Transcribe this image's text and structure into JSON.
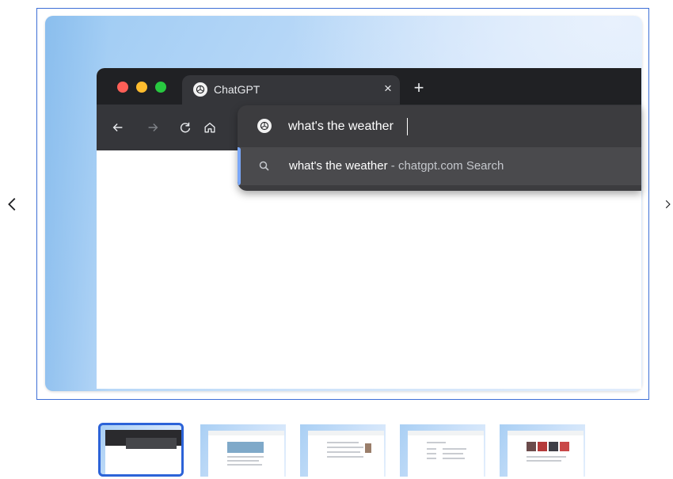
{
  "viewer": {
    "prev_label": "<",
    "next_label": ">",
    "selected_index": 0,
    "thumbnail_count": 5
  },
  "browser": {
    "tab": {
      "title": "ChatGPT",
      "favicon": "chatgpt-logo-icon",
      "close_glyph": "×"
    },
    "new_tab_glyph": "+",
    "toolbar": {
      "icons": [
        "back-arrow-icon",
        "forward-arrow-icon",
        "reload-icon",
        "home-icon"
      ]
    },
    "omnibox": {
      "value": "what's the weather",
      "favicon": "chatgpt-logo-icon",
      "suggestion": {
        "icon": "search-icon",
        "query": "what's the weather",
        "separator": " - ",
        "destination": "chatgpt.com Search"
      }
    }
  },
  "colors": {
    "frame_border": "#3d6fd6",
    "tab_strip": "#202124",
    "toolbar": "#35363a",
    "omnibox": "#3c3c3f",
    "suggestion_highlight": "#4a4a4d",
    "accent": "#7aa7f7",
    "traffic_red": "#fe5f57",
    "traffic_yellow": "#febc2e",
    "traffic_green": "#28c840"
  }
}
